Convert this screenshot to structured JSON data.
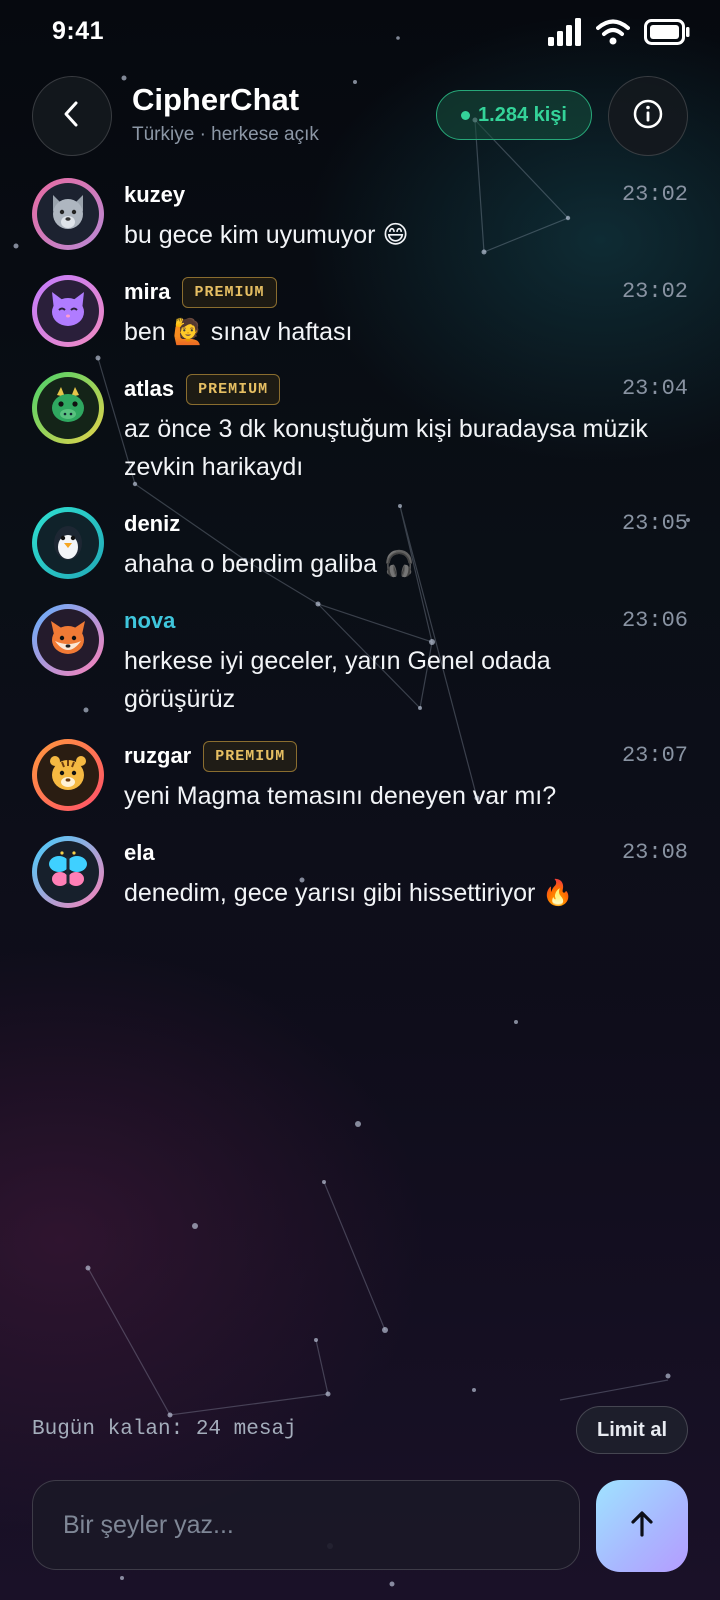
{
  "status_bar": {
    "time": "9:41",
    "icons": [
      "signal-icon",
      "wifi-icon",
      "battery-icon"
    ]
  },
  "header": {
    "title": "CipherChat",
    "subtitle": "Türkiye · herkese açık",
    "online_count": "1.284 kişi",
    "back_icon": "chevron-left-icon",
    "info_icon": "info-icon"
  },
  "messages": [
    {
      "user": "kuzey",
      "premium": false,
      "time": "23:02",
      "text": "bu gece kim uyumuyor 😄",
      "avatar": "wolf",
      "ring": [
        "#e86aa0",
        "#b98ad6"
      ]
    },
    {
      "user": "mira",
      "premium": true,
      "time": "23:02",
      "text": "ben 🙋 sınav haftası",
      "avatar": "cat",
      "ring": [
        "#c27cff",
        "#f08ac0"
      ]
    },
    {
      "user": "atlas",
      "premium": true,
      "time": "23:04",
      "text": "az önce 3 dk konuştuğum kişi buradaysa müzik zevkin harikaydı",
      "avatar": "dragon",
      "ring": [
        "#47d16b",
        "#e6d34a"
      ]
    },
    {
      "user": "deniz",
      "premium": false,
      "time": "23:05",
      "text": "ahaha o bendim galiba 🎧",
      "avatar": "penguin",
      "ring": [
        "#2fe0d0",
        "#22a9b8"
      ]
    },
    {
      "user": "nova",
      "premium": false,
      "time": "23:06",
      "text": "herkese iyi geceler, yarın Genel odada görüşürüz",
      "avatar": "fox",
      "ring": [
        "#5fb0ff",
        "#ff7fb6"
      ],
      "name_color": "#3fc6dc"
    },
    {
      "user": "ruzgar",
      "premium": true,
      "time": "23:07",
      "text": "yeni Magma temasını deneyen var mı?",
      "avatar": "tiger",
      "ring": [
        "#ff9a3c",
        "#ff4f6a"
      ]
    },
    {
      "user": "ela",
      "premium": false,
      "time": "23:08",
      "text": "denedim, gece yarısı gibi hissettiriyor 🔥",
      "avatar": "butterfly",
      "ring": [
        "#3fd0ff",
        "#ff7fb6"
      ]
    }
  ],
  "premium_label": "PREMIUM",
  "footer": {
    "limit_text": "Bugün kalan: 24 mesaj",
    "limit_button": "Limit al",
    "input_placeholder": "Bir şeyler yaz...",
    "send_icon": "arrow-up-icon"
  },
  "colors": {
    "online": "#34d399",
    "premium": "#e6bf63",
    "accent_send": "#a9b6ff"
  }
}
